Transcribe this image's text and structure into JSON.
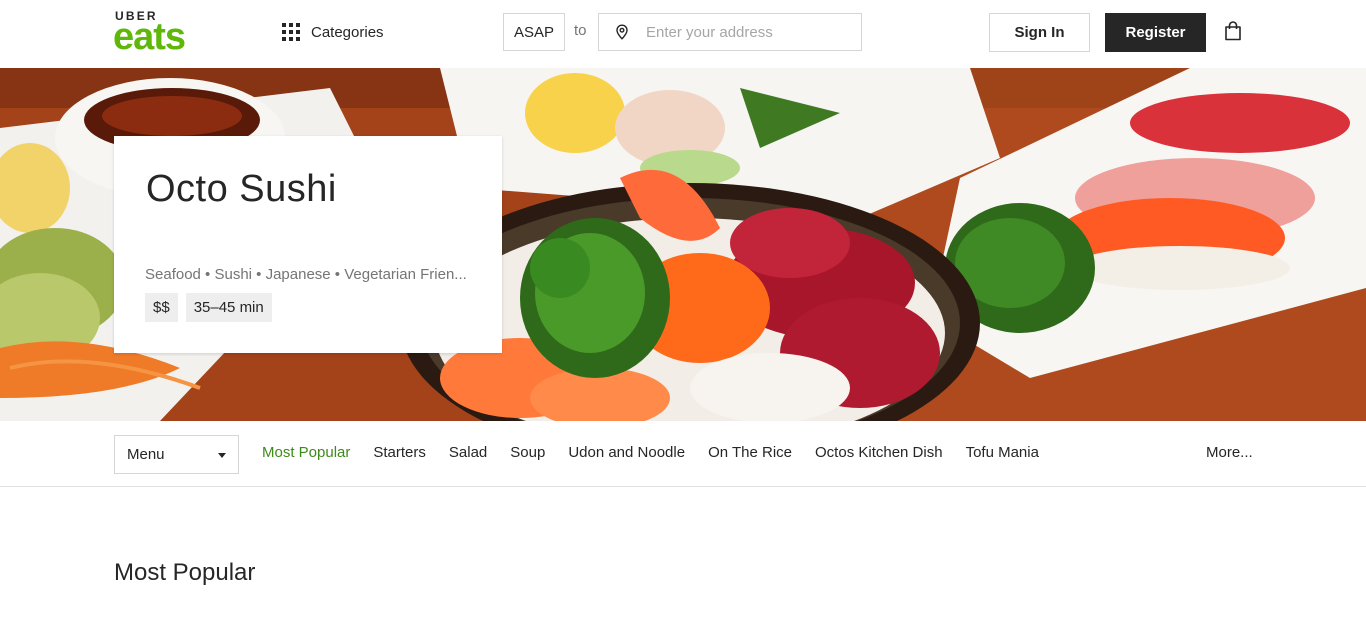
{
  "header": {
    "logo_top": "UBER",
    "logo_bottom": "eats",
    "categories_label": "Categories",
    "time_label": "ASAP",
    "to_label": "to",
    "address_placeholder": "Enter your address",
    "signin_label": "Sign In",
    "register_label": "Register"
  },
  "restaurant": {
    "name": "Octo Sushi",
    "cuisines": "Seafood • Sushi • Japanese • Vegetarian Frien...",
    "price": "$$",
    "eta": "35–45 min"
  },
  "menubar": {
    "select_value": "Menu",
    "links": [
      {
        "label": "Most Popular",
        "active": true
      },
      {
        "label": "Starters"
      },
      {
        "label": "Salad"
      },
      {
        "label": "Soup"
      },
      {
        "label": "Udon and Noodle"
      },
      {
        "label": "On The Rice"
      },
      {
        "label": "Octos Kitchen Dish"
      },
      {
        "label": "Tofu Mania"
      }
    ],
    "more_label": "More..."
  },
  "section": {
    "title": "Most Popular"
  },
  "colors": {
    "brand_green": "#5fb709",
    "active_link": "#3d8b1a",
    "dark": "#262626"
  },
  "icons": [
    "grid-icon",
    "location-pin-icon",
    "shopping-bag-icon",
    "chevron-down-icon"
  ]
}
